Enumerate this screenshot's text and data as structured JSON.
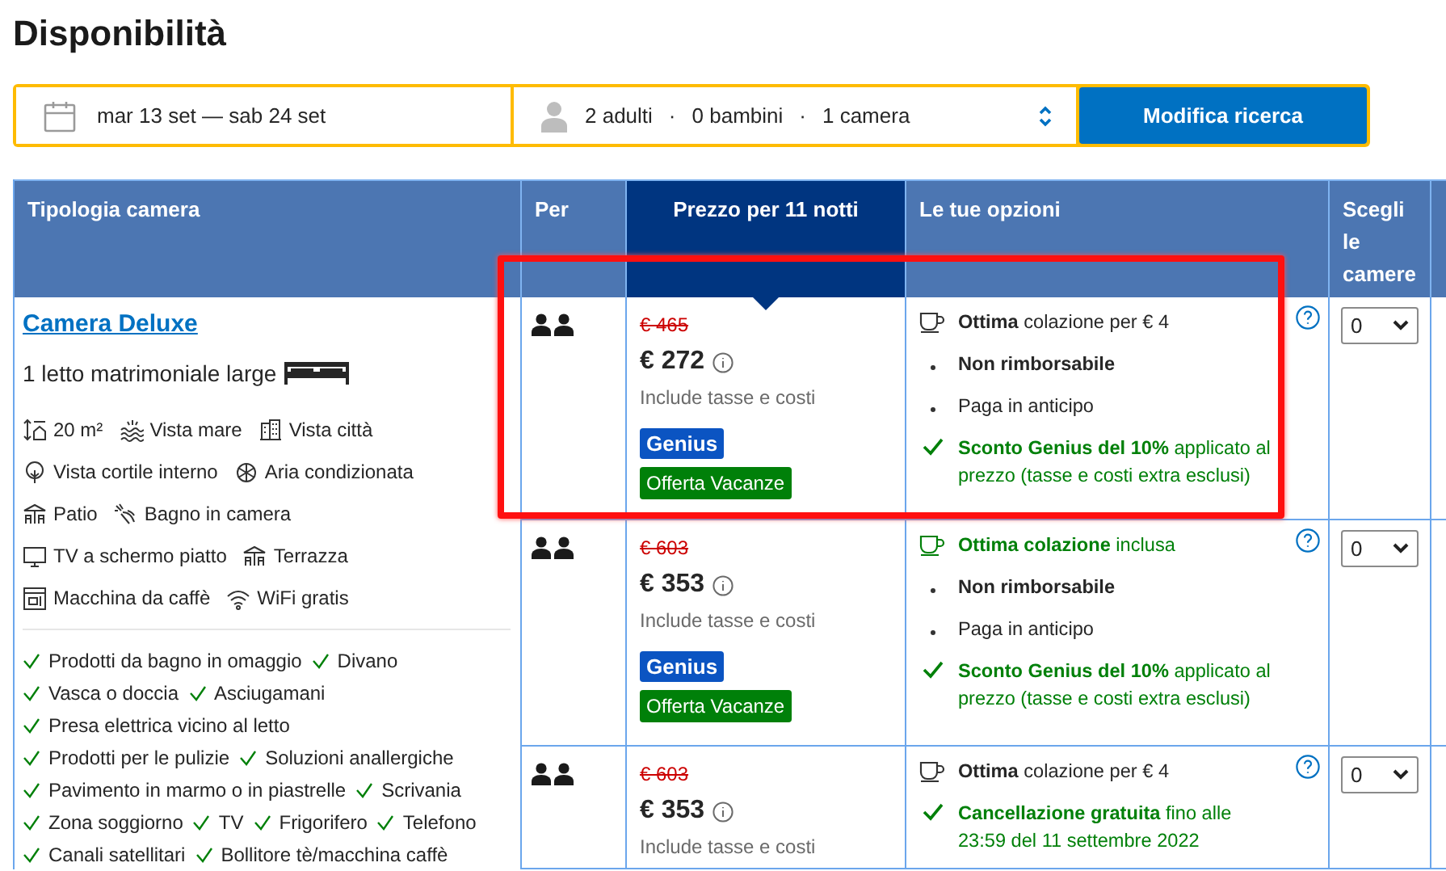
{
  "title": "Disponibilità",
  "search": {
    "dates": "mar 13 set — sab 24 set",
    "guests": [
      "2 adulti",
      "0 bambini",
      "1 camera"
    ],
    "separator": "·",
    "button": "Modifica ricerca"
  },
  "table": {
    "columns": [
      {
        "label": "Tipologia camera",
        "selected": false
      },
      {
        "label": "Per",
        "selected": false
      },
      {
        "label": "Prezzo per 11 notti",
        "selected": true
      },
      {
        "label": "Le tue opzioni",
        "selected": false
      },
      {
        "label": "Scegli le camere",
        "selected": false
      }
    ],
    "room": {
      "name": "Camera Deluxe",
      "bed": "1 letto matrimoniale large",
      "facility_rows": [
        [
          "20 m²",
          "Vista mare",
          "Vista città"
        ],
        [
          "Vista cortile interno",
          "Aria condizionata"
        ],
        [
          "Patio",
          "Bagno in camera"
        ],
        [
          "TV a schermo piatto",
          "Terrazza"
        ],
        [
          "Macchina da caffè",
          "WiFi gratis"
        ]
      ],
      "amenity_rows": [
        [
          "Prodotti da bagno in omaggio",
          "Divano"
        ],
        [
          "Vasca o doccia",
          "Asciugamani"
        ],
        [
          "Presa elettrica vicino al letto"
        ],
        [
          "Prodotti per le pulizie",
          "Soluzioni anallergiche"
        ],
        [
          "Pavimento in marmo o in piastrelle",
          "Scrivania"
        ],
        [
          "Zona soggiorno",
          "TV",
          "Frigorifero",
          "Telefono"
        ],
        [
          "Canali satellitari",
          "Bollitore tè/macchina caffè"
        ]
      ]
    },
    "offers": [
      {
        "highlighted": true,
        "original_price": "€ 465",
        "price": "€ 272",
        "taxes_note": "Include tasse e costi",
        "badges": [
          {
            "kind": "genius",
            "label": "Genius"
          },
          {
            "kind": "deal",
            "label": "Offerta Vacanze"
          }
        ],
        "options": [
          {
            "kind": "meal",
            "included": false,
            "text": "**Ottima** colazione per € 4"
          },
          {
            "kind": "policy",
            "emphasis": true,
            "text": "Non rimborsabile"
          },
          {
            "kind": "policy",
            "emphasis": false,
            "text": "Paga in anticipo"
          },
          {
            "kind": "benefit",
            "text": "**Sconto Genius del 10%** applicato al prezzo (tasse e costi extra esclusi)"
          }
        ],
        "quantity": "0"
      },
      {
        "highlighted": false,
        "original_price": "€ 603",
        "price": "€ 353",
        "taxes_note": "Include tasse e costi",
        "badges": [
          {
            "kind": "genius",
            "label": "Genius"
          },
          {
            "kind": "deal",
            "label": "Offerta Vacanze"
          }
        ],
        "options": [
          {
            "kind": "meal",
            "included": true,
            "text": "**Ottima colazione** inclusa"
          },
          {
            "kind": "policy",
            "emphasis": true,
            "text": "Non rimborsabile"
          },
          {
            "kind": "policy",
            "emphasis": false,
            "text": "Paga in anticipo"
          },
          {
            "kind": "benefit",
            "text": "**Sconto Genius del 10%** applicato al prezzo (tasse e costi extra esclusi)"
          }
        ],
        "quantity": "0"
      },
      {
        "highlighted": false,
        "original_price": "€ 603",
        "price": "€ 353",
        "taxes_note": "Include tasse e costi",
        "options": [
          {
            "kind": "meal",
            "included": false,
            "text": "**Ottima** colazione per € 4"
          },
          {
            "kind": "benefit",
            "text": "**Cancellazione gratuita** fino alle 23:59 del 11 settembre 2022"
          }
        ],
        "quantity": "0"
      }
    ]
  }
}
